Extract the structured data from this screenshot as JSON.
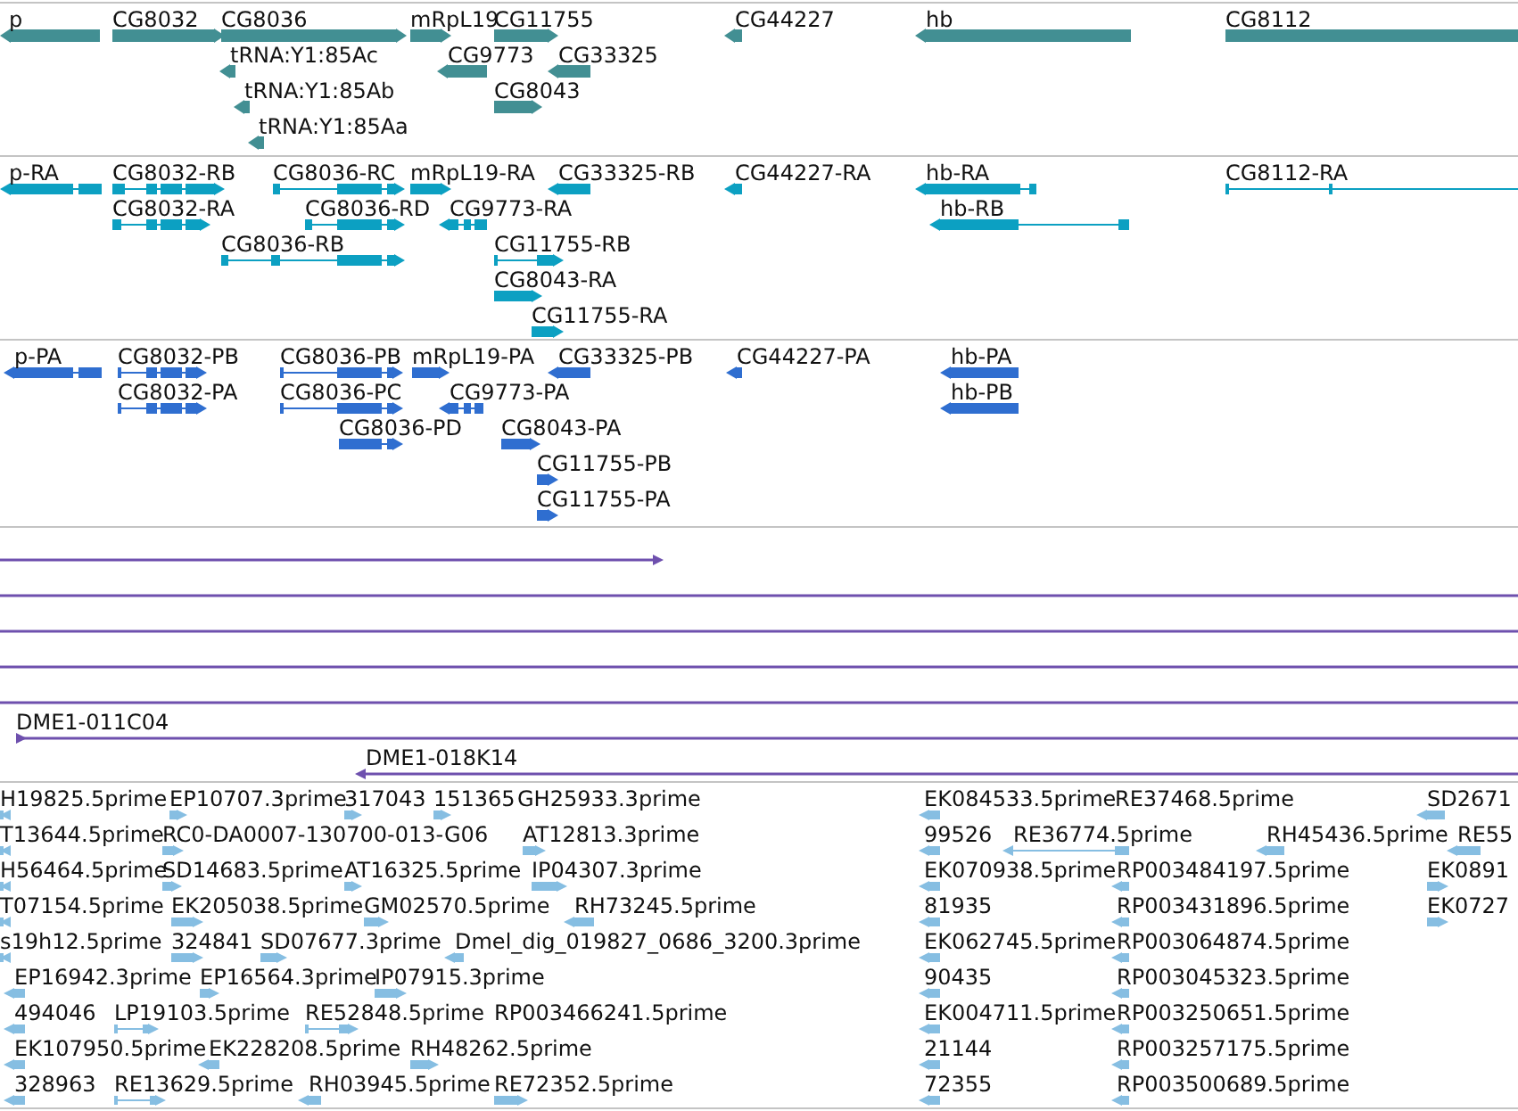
{
  "tracks": [
    {
      "kind": "gene",
      "features": [
        {
          "label": "p",
          "reverse": true
        },
        {
          "label": "CG8032",
          "reverse": false
        },
        {
          "label": "CG8036",
          "reverse": false
        },
        {
          "label": "mRpL19",
          "reverse": false
        },
        {
          "label": "CG11755",
          "reverse": false
        },
        {
          "label": "CG44227",
          "reverse": true
        },
        {
          "label": "hb",
          "reverse": true
        },
        {
          "label": "CG8112",
          "reverse": false
        },
        {
          "label": "tRNA:Y1:85Ac",
          "reverse": true
        },
        {
          "label": "CG9773",
          "reverse": true
        },
        {
          "label": "CG33325",
          "reverse": true
        },
        {
          "label": "tRNA:Y1:85Ab",
          "reverse": true
        },
        {
          "label": "CG8043",
          "reverse": false
        },
        {
          "label": "tRNA:Y1:85Aa",
          "reverse": true
        }
      ]
    },
    {
      "kind": "transcript",
      "features": [
        {
          "label": "p-RA",
          "reverse": true
        },
        {
          "label": "CG8032-RB",
          "reverse": false
        },
        {
          "label": "CG8036-RC",
          "reverse": false
        },
        {
          "label": "mRpL19-RA",
          "reverse": false
        },
        {
          "label": "CG33325-RB",
          "reverse": true
        },
        {
          "label": "CG44227-RA",
          "reverse": true
        },
        {
          "label": "hb-RA",
          "reverse": true
        },
        {
          "label": "CG8112-RA",
          "reverse": false
        },
        {
          "label": "CG8032-RA",
          "reverse": false
        },
        {
          "label": "CG8036-RD",
          "reverse": false
        },
        {
          "label": "CG9773-RA",
          "reverse": true
        },
        {
          "label": "hb-RB",
          "reverse": true
        },
        {
          "label": "CG8036-RB",
          "reverse": false
        },
        {
          "label": "CG11755-RB",
          "reverse": false
        },
        {
          "label": "CG8043-RA",
          "reverse": false
        },
        {
          "label": "CG11755-RA",
          "reverse": false
        }
      ]
    },
    {
      "kind": "protein",
      "features": [
        {
          "label": "p-PA",
          "reverse": true
        },
        {
          "label": "CG8032-PB",
          "reverse": false
        },
        {
          "label": "CG8036-PB",
          "reverse": false
        },
        {
          "label": "mRpL19-PA",
          "reverse": false
        },
        {
          "label": "CG33325-PB",
          "reverse": true
        },
        {
          "label": "CG44227-PA",
          "reverse": true
        },
        {
          "label": "hb-PA",
          "reverse": true
        },
        {
          "label": "CG8032-PA",
          "reverse": false
        },
        {
          "label": "CG8036-PC",
          "reverse": false
        },
        {
          "label": "CG9773-PA",
          "reverse": true
        },
        {
          "label": "hb-PB",
          "reverse": true
        },
        {
          "label": "CG8036-PD",
          "reverse": false
        },
        {
          "label": "CG8043-PA",
          "reverse": false
        },
        {
          "label": "CG11755-PB",
          "reverse": false
        },
        {
          "label": "CG11755-PA",
          "reverse": false
        }
      ]
    },
    {
      "kind": "clone",
      "features": [
        {
          "reverse": false
        },
        {
          "reverse": false
        },
        {
          "reverse": false
        },
        {
          "reverse": false
        },
        {
          "reverse": false
        },
        {
          "label": "DME1-011C04",
          "reverse": false
        },
        {
          "label": "DME1-018K14",
          "reverse": true
        }
      ]
    },
    {
      "kind": "est",
      "features": [
        {
          "label": "H19825.5prime",
          "reverse": true
        },
        {
          "label": "EP10707.3prime",
          "reverse": false
        },
        {
          "label": "317043",
          "reverse": false
        },
        {
          "label": "151365",
          "reverse": false
        },
        {
          "label": "GH25933.3prime"
        },
        {
          "label": "EK084533.5prime",
          "reverse": true
        },
        {
          "label": "RE37468.5prime"
        },
        {
          "label": "SD2671",
          "reverse": true
        },
        {
          "label": "T13644.5prime",
          "reverse": true
        },
        {
          "label": "RC0-DA0007-130700-013-G06",
          "reverse": false
        },
        {
          "label": "AT12813.3prime",
          "reverse": false
        },
        {
          "label": "99526",
          "reverse": true
        },
        {
          "label": "RE36774.5prime",
          "reverse": true
        },
        {
          "label": "RH45436.5prime",
          "reverse": true
        },
        {
          "label": "RE55",
          "reverse": true
        },
        {
          "label": "H56464.5prime",
          "reverse": true
        },
        {
          "label": "SD14683.5prime",
          "reverse": false
        },
        {
          "label": "AT16325.5prime",
          "reverse": false
        },
        {
          "label": "IP04307.3prime",
          "reverse": false
        },
        {
          "label": "EK070938.5prime",
          "reverse": true
        },
        {
          "label": "RP003484197.5prime",
          "reverse": true
        },
        {
          "label": "EK0891",
          "reverse": false
        },
        {
          "label": "T07154.5prime",
          "reverse": true
        },
        {
          "label": "EK205038.5prime",
          "reverse": false
        },
        {
          "label": "GM02570.5prime",
          "reverse": false
        },
        {
          "label": "RH73245.5prime",
          "reverse": true
        },
        {
          "label": "81935",
          "reverse": true
        },
        {
          "label": "RP003431896.5prime",
          "reverse": true
        },
        {
          "label": "EK0727",
          "reverse": false
        },
        {
          "label": "s19h12.5prime",
          "reverse": true
        },
        {
          "label": "324841",
          "reverse": false
        },
        {
          "label": "SD07677.3prime",
          "reverse": false
        },
        {
          "label": "Dmel_dig_019827_0686_3200.3prime",
          "reverse": true
        },
        {
          "label": "EK062745.5prime",
          "reverse": true
        },
        {
          "label": "RP003064874.5prime",
          "reverse": true
        },
        {
          "label": "EP16942.3prime",
          "reverse": true
        },
        {
          "label": "EP16564.3prime",
          "reverse": false
        },
        {
          "label": "IP07915.3prime",
          "reverse": false
        },
        {
          "label": "90435",
          "reverse": true
        },
        {
          "label": "RP003045323.5prime",
          "reverse": true
        },
        {
          "label": "494046",
          "reverse": true
        },
        {
          "label": "LP19103.5prime",
          "reverse": false
        },
        {
          "label": "RE52848.5prime",
          "reverse": false
        },
        {
          "label": "RP003466241.5prime"
        },
        {
          "label": "EK004711.5prime",
          "reverse": true
        },
        {
          "label": "RP003250651.5prime",
          "reverse": true
        },
        {
          "label": "EK107950.5prime",
          "reverse": true
        },
        {
          "label": "EK228208.5prime",
          "reverse": true
        },
        {
          "label": "RH48262.5prime",
          "reverse": false
        },
        {
          "label": "21144",
          "reverse": true
        },
        {
          "label": "RP003257175.5prime",
          "reverse": true
        },
        {
          "label": "328963",
          "reverse": true
        },
        {
          "label": "RE13629.5prime",
          "reverse": false
        },
        {
          "label": "RH03945.5prime",
          "reverse": true
        },
        {
          "label": "RE72352.5prime",
          "reverse": false
        },
        {
          "label": "72355",
          "reverse": true
        },
        {
          "label": "RP003500689.5prime",
          "reverse": true
        }
      ]
    }
  ]
}
